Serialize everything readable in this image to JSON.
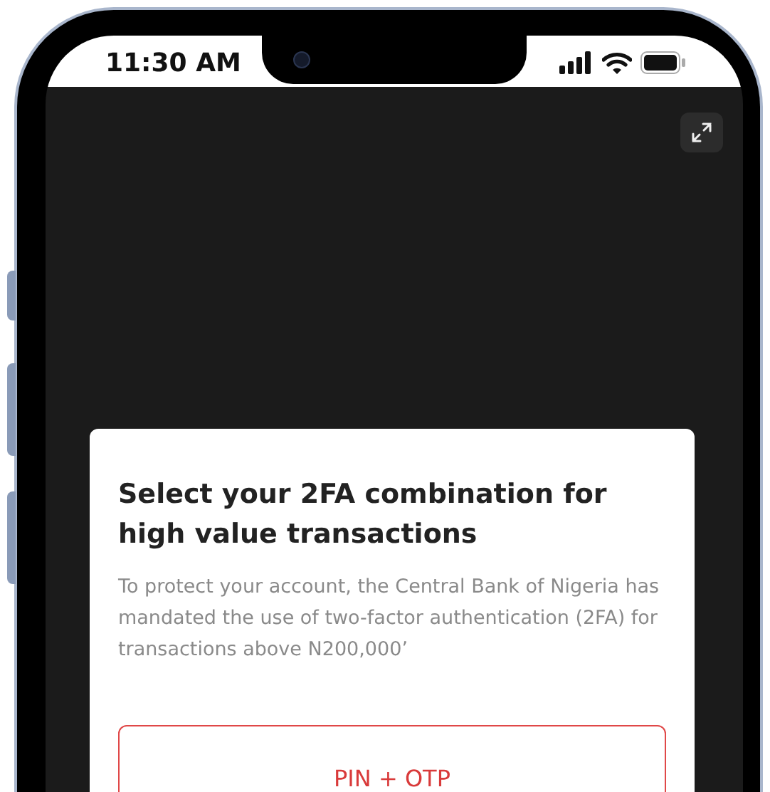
{
  "status_bar": {
    "time": "11:30 AM"
  },
  "modal": {
    "title": "Select your 2FA combination for high value transactions",
    "description": "To protect your account, the Central Bank of Nigeria has mandated the use of two-factor authentication (2FA) for transactions above N200,000’",
    "options": [
      {
        "label": "PIN + OTP"
      }
    ]
  }
}
